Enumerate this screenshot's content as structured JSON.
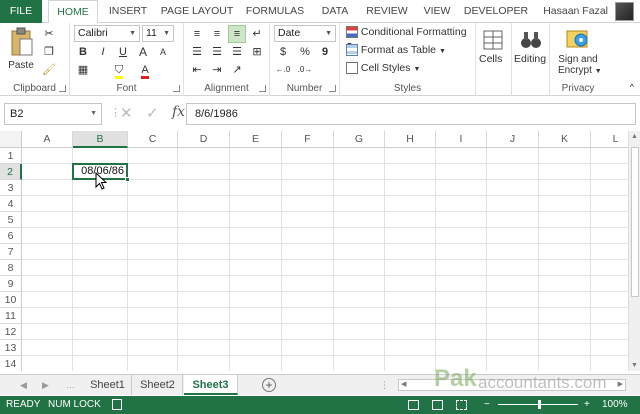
{
  "tabs": {
    "file": "FILE",
    "items": [
      "HOME",
      "INSERT",
      "PAGE LAYOUT",
      "FORMULAS",
      "DATA",
      "REVIEW",
      "VIEW",
      "DEVELOPER"
    ],
    "user": "Hasaan Fazal"
  },
  "ribbon": {
    "clipboard": {
      "label": "Clipboard",
      "paste": "Paste"
    },
    "font": {
      "label": "Font",
      "name": "Calibri",
      "size": "11",
      "bold": "B",
      "italic": "I",
      "underline": "U",
      "grow": "A",
      "shrink": "A",
      "color": "A"
    },
    "alignment": {
      "label": "Alignment"
    },
    "number": {
      "label": "Number",
      "format": "Date",
      "currency": "$",
      "percent": "%",
      "comma": "9"
    },
    "styles": {
      "label": "Styles",
      "conditional": "Conditional Formatting",
      "table": "Format as Table",
      "cell": "Cell Styles"
    },
    "cells": {
      "label": "Cells"
    },
    "editing": {
      "label": "Editing"
    },
    "privacy": {
      "label": "Privacy",
      "sign": "Sign and",
      "encrypt": "Encrypt"
    }
  },
  "formula_bar": {
    "name_box": "B2",
    "fx": "fx",
    "value": "8/6/1986"
  },
  "grid": {
    "columns": [
      "A",
      "B",
      "C",
      "D",
      "E",
      "F",
      "G",
      "H",
      "I",
      "J",
      "K",
      "L"
    ],
    "rows": [
      "1",
      "2",
      "3",
      "4",
      "5",
      "6",
      "7",
      "8",
      "9",
      "10",
      "11",
      "12",
      "13",
      "14"
    ],
    "selected_value": "08/06/86"
  },
  "sheets": {
    "items": [
      "Sheet1",
      "Sheet2",
      "Sheet3"
    ],
    "active": "Sheet3",
    "watermark_a": "Pak",
    "watermark_b": "accountants.com"
  },
  "status": {
    "mode": "READY",
    "numlock": "NUM LOCK",
    "zoom": "100%"
  },
  "colors": {
    "accent": "#217346"
  }
}
